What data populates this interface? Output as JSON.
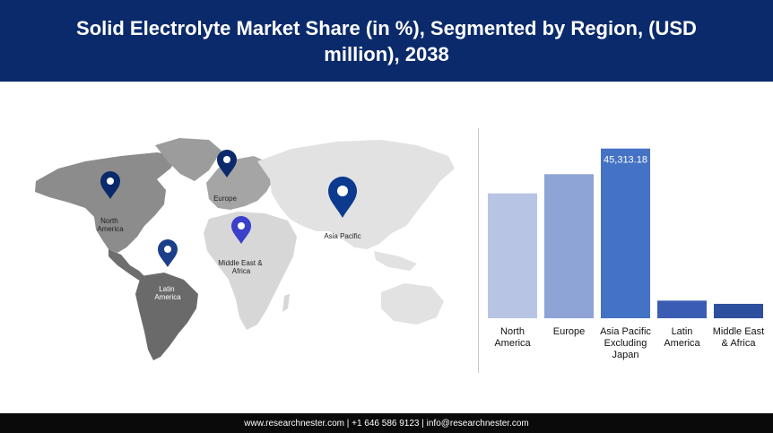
{
  "header": {
    "title": "Solid Electrolyte Market Share (in %), Segmented by Region, (USD million), 2038"
  },
  "map": {
    "pins": [
      {
        "name": "north-america",
        "label_lines": [
          "North",
          "America"
        ],
        "color": "#0b2a6b"
      },
      {
        "name": "europe",
        "label_lines": [
          "Europe"
        ],
        "color": "#0b2a6b"
      },
      {
        "name": "asia-pacific",
        "label_lines": [
          "Asia Pacific"
        ],
        "color": "#0b3a8f"
      },
      {
        "name": "middle-east-africa",
        "label_lines": [
          "Middle East &",
          "Africa"
        ],
        "color": "#3b3fc9"
      },
      {
        "name": "latin-america",
        "label_lines": [
          "Latin",
          "America"
        ],
        "color": "#1c3f8a"
      }
    ]
  },
  "chart_data": {
    "type": "bar",
    "categories": [
      [
        "North",
        "America"
      ],
      [
        "Europe"
      ],
      [
        "Asia Pacific",
        "Excluding",
        "Japan"
      ],
      [
        "Latin",
        "America"
      ],
      [
        "Middle East",
        "& Africa"
      ]
    ],
    "values": [
      39000,
      45000,
      53000,
      5500,
      4500
    ],
    "colors": [
      "#b8c4e3",
      "#8ea4d6",
      "#4472c4",
      "#3a5db3",
      "#2e4f9e"
    ],
    "data_labels": [
      "",
      "",
      "45,313.18",
      "",
      ""
    ],
    "ylim": [
      0,
      56000
    ],
    "grid": false,
    "legend": "none"
  },
  "footer": {
    "text": "www.researchnester.com | +1 646 586 9123 | info@researchnester.com"
  }
}
